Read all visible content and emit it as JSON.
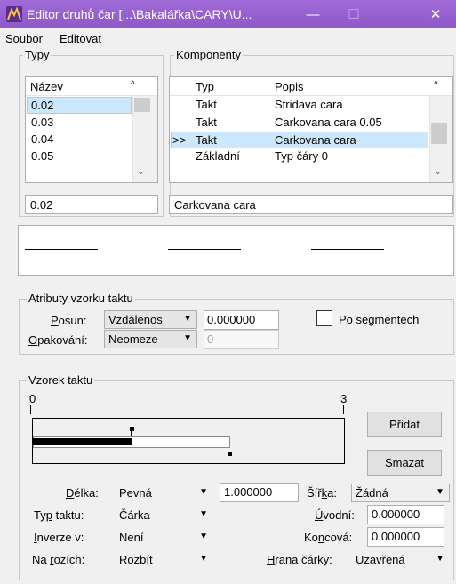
{
  "window": {
    "title": "Editor druhů čar [...\\Bakalářka\\CARY\\U...",
    "minimize_glyph": "—",
    "maximize_glyph": "☐",
    "close_glyph": "✕"
  },
  "menu": {
    "items": [
      {
        "prefix": "",
        "accel": "S",
        "rest": "oubor"
      },
      {
        "prefix": "",
        "accel": "E",
        "rest": "ditovat"
      }
    ]
  },
  "types": {
    "group_label": "Typy",
    "column_header": "Název",
    "rows": [
      "0.02",
      "0.03",
      "0.04",
      "0.05"
    ],
    "selected_index": 0,
    "edit_value": "0.02"
  },
  "components": {
    "group_label": "Komponenty",
    "headers": {
      "type": "Typ",
      "desc": "Popis"
    },
    "rows": [
      {
        "marker": "",
        "type": "Takt",
        "desc": "Stridava cara"
      },
      {
        "marker": "",
        "type": "Takt",
        "desc": "Carkovana cara 0.05"
      },
      {
        "marker": ">>",
        "type": "Takt",
        "desc": "Carkovana cara"
      },
      {
        "marker": "",
        "type": "Základní",
        "desc": "Typ čáry 0"
      }
    ],
    "selected_index": 2,
    "edit_value": "Carkovana cara"
  },
  "pattern_attrs": {
    "group_label": "Atributy vzorku taktu",
    "shift_label": {
      "prefix": "",
      "accel": "P",
      "rest": "osun:"
    },
    "shift_value": "Vzdálenos",
    "shift_number": "0.000000",
    "repeat_label": {
      "prefix": "",
      "accel": "O",
      "rest": "pakování:"
    },
    "repeat_value": "Neomeze",
    "repeat_number": "0",
    "per_segment": {
      "prefix": "Po se",
      "accel": "g",
      "rest": "mentech"
    }
  },
  "pattern": {
    "group_label": "Vzorek taktu",
    "ruler_start": "0",
    "ruler_end": "3",
    "add_button": "Přidat",
    "delete_button": "Smazat"
  },
  "fields": {
    "length_label": {
      "prefix": "",
      "accel": "D",
      "rest": "élka:"
    },
    "length_mode": "Pevná",
    "length_value": "1.000000",
    "width_label": {
      "prefix": "Šíř",
      "accel": "k",
      "rest": "a:"
    },
    "width_value": "Žádná",
    "stroke_type_label": {
      "prefix": "Ty",
      "accel": "p",
      "rest": " taktu:"
    },
    "stroke_type_value": "Čárka",
    "start_label": {
      "prefix": "",
      "accel": "Ú",
      "rest": "vodní:"
    },
    "start_value": "0.000000",
    "invert_label": {
      "prefix": "",
      "accel": "I",
      "rest": "nverze v:"
    },
    "invert_value": "Není",
    "end_label": {
      "prefix": "Ko",
      "accel": "n",
      "rest": "cová:"
    },
    "end_value": "0.000000",
    "corners_label": {
      "prefix": "Na ",
      "accel": "r",
      "rest": "ozích:"
    },
    "corners_value": "Rozbít",
    "cap_label": {
      "prefix": "",
      "accel": "H",
      "rest": "rana čárky:"
    },
    "cap_value": "Uzavřená"
  }
}
